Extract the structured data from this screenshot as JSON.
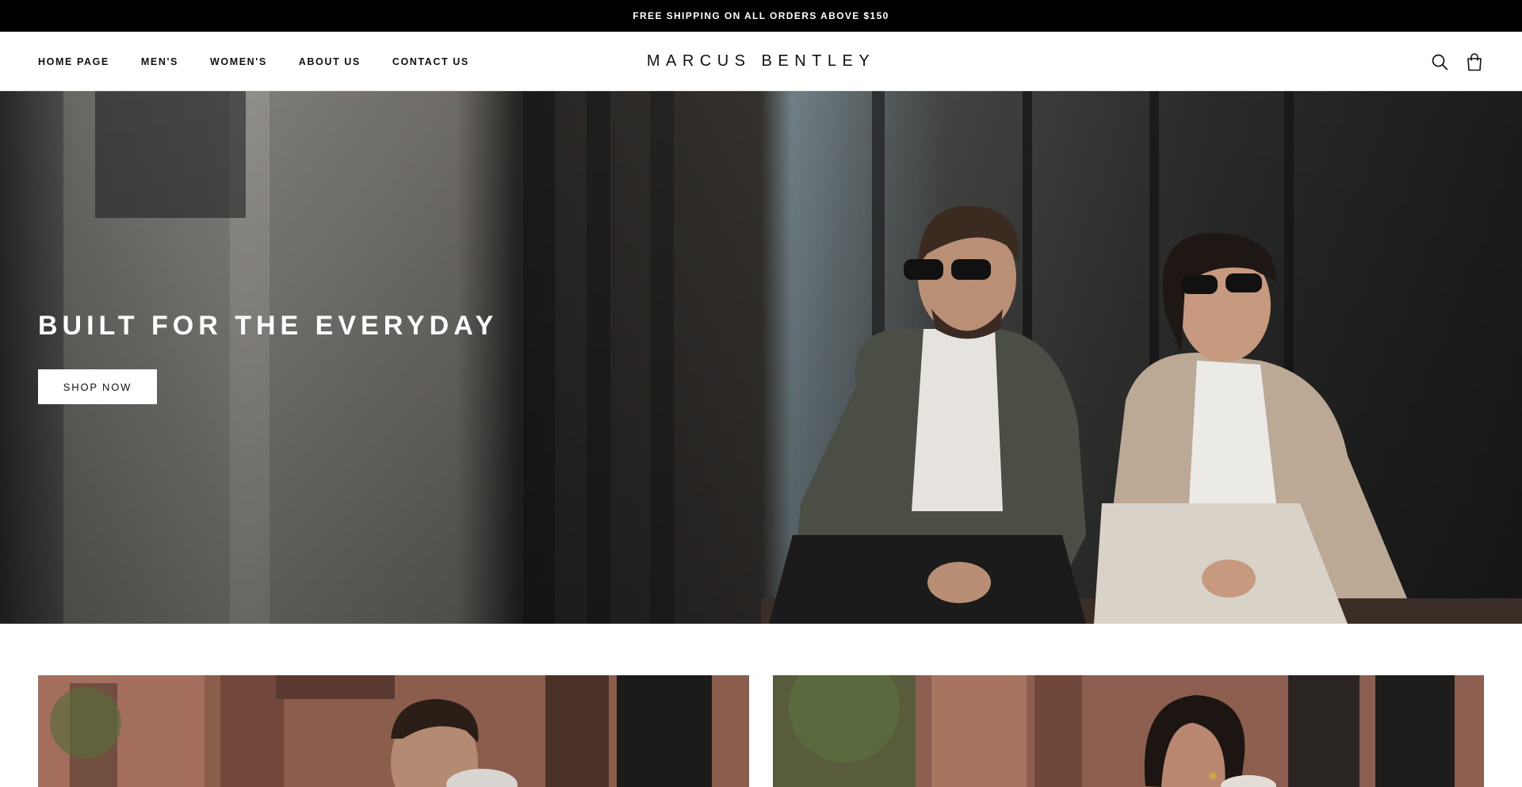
{
  "announcement": {
    "text": "FREE SHIPPING ON ALL ORDERS ABOVE $150"
  },
  "header": {
    "nav": [
      {
        "label": "HOME PAGE"
      },
      {
        "label": "MEN'S"
      },
      {
        "label": "WOMEN'S"
      },
      {
        "label": "ABOUT US"
      },
      {
        "label": "CONTACT US"
      }
    ],
    "logo": "MARCUS BENTLEY",
    "icons": [
      "search-icon",
      "bag-icon"
    ]
  },
  "hero": {
    "title": "BUILT FOR THE EVERYDAY",
    "cta_label": "SHOP NOW"
  },
  "collections": [
    {
      "image": "man-on-brownstone-steps"
    },
    {
      "image": "woman-on-brownstone-steps"
    }
  ],
  "colors": {
    "announcement_bg": "#000000",
    "text": "#111111",
    "button_bg": "#ffffff"
  }
}
